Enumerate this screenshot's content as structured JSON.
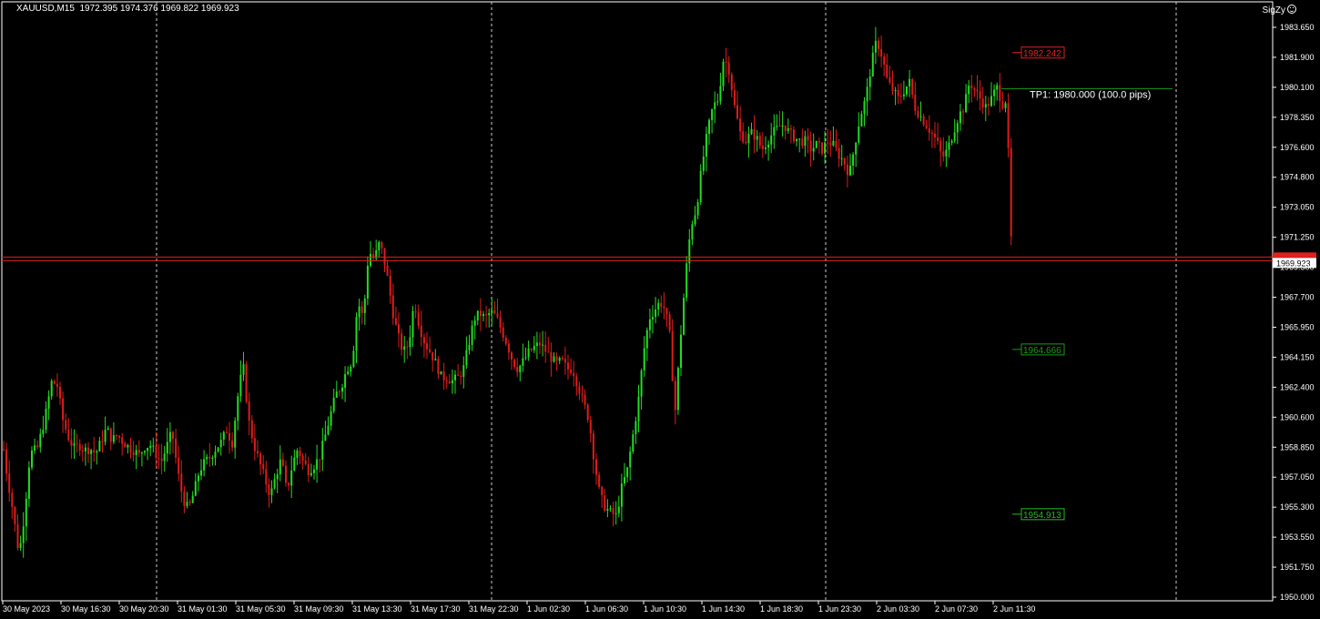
{
  "window": {
    "symbol_tf": "XAUUSD,M15",
    "ohlc": "1972.395 1974.376 1969.822 1969.923",
    "brand": "SigZy"
  },
  "colors": {
    "background": "#000000",
    "bull": "#22dd22",
    "bear": "#dd1c1c",
    "grid": "#cccccc",
    "axis": "#ffffff",
    "price_line": "#e0201e",
    "tp_line": "#1a9a1a"
  },
  "chart_data": {
    "type": "candlestick",
    "symbol": "XAUUSD",
    "timeframe": "M15",
    "ylim": [
      1950.0,
      1984.6
    ],
    "y_ticks": [
      "1983.650",
      "1981.900",
      "1980.100",
      "1978.350",
      "1976.600",
      "1974.800",
      "1973.050",
      "1971.250",
      "1969.500",
      "1967.700",
      "1965.950",
      "1964.150",
      "1962.400",
      "1960.600",
      "1958.850",
      "1957.050",
      "1955.300",
      "1953.550",
      "1951.750",
      "1950.000"
    ],
    "x_ticks": [
      "30 May 2023",
      "30 May 16:30",
      "30 May 20:30",
      "31 May 01:30",
      "31 May 05:30",
      "31 May 09:30",
      "31 May 13:30",
      "31 May 17:30",
      "31 May 22:30",
      "1 Jun 02:30",
      "1 Jun 06:30",
      "1 Jun 10:30",
      "1 Jun 14:30",
      "1 Jun 18:30",
      "1 Jun 23:30",
      "2 Jun 03:30",
      "2 Jun 07:30",
      "2 Jun 11:30"
    ],
    "current_price": "1969.923",
    "levels": [
      {
        "name": "level-high",
        "price": 1982.242,
        "label": "1982.242",
        "color": "#dd2222"
      },
      {
        "name": "level-mid",
        "price": 1964.666,
        "label": "1964.666",
        "color": "#1a9a1a"
      },
      {
        "name": "level-low",
        "price": 1954.913,
        "label": "1954.913",
        "color": "#22bb22"
      }
    ],
    "tp": {
      "price": 1980.0,
      "label": "TP1: 1980.000 (100.0 pips)"
    },
    "day_separators": [
      "30 May 20:30",
      "31 May 22:30",
      "1 Jun 23:30"
    ],
    "close_path": [
      [
        0,
        1960.0
      ],
      [
        6,
        1957.5
      ],
      [
        12,
        1955.5
      ],
      [
        20,
        1952.5
      ],
      [
        26,
        1955.0
      ],
      [
        32,
        1958.5
      ],
      [
        40,
        1958.8
      ],
      [
        48,
        1960.5
      ],
      [
        56,
        1962.8
      ],
      [
        62,
        1962.5
      ],
      [
        68,
        1960.5
      ],
      [
        74,
        1959.5
      ],
      [
        80,
        1958.8
      ],
      [
        86,
        1959.0
      ],
      [
        92,
        1958.7
      ],
      [
        98,
        1958.8
      ],
      [
        104,
        1958.5
      ],
      [
        110,
        1959.2
      ],
      [
        116,
        1960.0
      ],
      [
        122,
        1959.3
      ],
      [
        128,
        1959.6
      ],
      [
        134,
        1959.2
      ],
      [
        140,
        1958.9
      ],
      [
        146,
        1958.7
      ],
      [
        152,
        1958.4
      ],
      [
        158,
        1958.9
      ],
      [
        164,
        1959.0
      ],
      [
        170,
        1958.5
      ],
      [
        176,
        1958.0
      ],
      [
        182,
        1958.9
      ],
      [
        188,
        1959.8
      ],
      [
        194,
        1957.5
      ],
      [
        200,
        1955.8
      ],
      [
        206,
        1955.2
      ],
      [
        212,
        1956.2
      ],
      [
        218,
        1957.5
      ],
      [
        224,
        1958.0
      ],
      [
        230,
        1958.3
      ],
      [
        236,
        1958.8
      ],
      [
        242,
        1959.2
      ],
      [
        248,
        1959.9
      ],
      [
        254,
        1959.1
      ],
      [
        260,
        1961.8
      ],
      [
        266,
        1963.8
      ],
      [
        272,
        1960.5
      ],
      [
        278,
        1959.0
      ],
      [
        284,
        1958.0
      ],
      [
        290,
        1957.0
      ],
      [
        296,
        1956.0
      ],
      [
        302,
        1957.2
      ],
      [
        308,
        1958.2
      ],
      [
        314,
        1956.2
      ],
      [
        320,
        1957.8
      ],
      [
        326,
        1958.8
      ],
      [
        332,
        1958.0
      ],
      [
        338,
        1957.5
      ],
      [
        344,
        1957.8
      ],
      [
        350,
        1958.3
      ],
      [
        356,
        1959.5
      ],
      [
        362,
        1960.8
      ],
      [
        368,
        1962.0
      ],
      [
        374,
        1962.5
      ],
      [
        380,
        1963.5
      ],
      [
        386,
        1964.0
      ],
      [
        392,
        1967.5
      ],
      [
        398,
        1966.5
      ],
      [
        404,
        1970.5
      ],
      [
        410,
        1970.0
      ],
      [
        416,
        1971.0
      ],
      [
        420,
        1970.2
      ],
      [
        426,
        1968.5
      ],
      [
        430,
        1967.0
      ],
      [
        436,
        1965.5
      ],
      [
        442,
        1964.5
      ],
      [
        448,
        1965.0
      ],
      [
        454,
        1967.5
      ],
      [
        460,
        1966.0
      ],
      [
        466,
        1965.0
      ],
      [
        472,
        1964.5
      ],
      [
        478,
        1963.8
      ],
      [
        484,
        1963.0
      ],
      [
        490,
        1963.0
      ],
      [
        496,
        1962.8
      ],
      [
        502,
        1963.0
      ],
      [
        508,
        1963.5
      ],
      [
        514,
        1965.0
      ],
      [
        520,
        1966.5
      ],
      [
        526,
        1966.8
      ],
      [
        532,
        1966.5
      ],
      [
        538,
        1966.9
      ],
      [
        544,
        1966.6
      ],
      [
        550,
        1965.8
      ],
      [
        556,
        1965.0
      ],
      [
        562,
        1964.0
      ],
      [
        568,
        1963.5
      ],
      [
        574,
        1964.0
      ],
      [
        580,
        1964.5
      ],
      [
        586,
        1964.8
      ],
      [
        592,
        1965.0
      ],
      [
        598,
        1964.6
      ],
      [
        604,
        1964.2
      ],
      [
        610,
        1963.8
      ],
      [
        616,
        1964.0
      ],
      [
        622,
        1963.5
      ],
      [
        628,
        1963.5
      ],
      [
        634,
        1962.5
      ],
      [
        640,
        1961.5
      ],
      [
        646,
        1960.5
      ],
      [
        652,
        1958.0
      ],
      [
        658,
        1956.0
      ],
      [
        664,
        1955.3
      ],
      [
        670,
        1955.0
      ],
      [
        676,
        1954.8
      ],
      [
        682,
        1956.5
      ],
      [
        688,
        1957.5
      ],
      [
        694,
        1959.5
      ],
      [
        700,
        1961.5
      ],
      [
        706,
        1964.5
      ],
      [
        712,
        1966.5
      ],
      [
        718,
        1967.0
      ],
      [
        724,
        1967.5
      ],
      [
        730,
        1967.0
      ],
      [
        736,
        1965.0
      ],
      [
        740,
        1960.5
      ],
      [
        746,
        1965.0
      ],
      [
        752,
        1969.0
      ],
      [
        758,
        1972.0
      ],
      [
        764,
        1973.0
      ],
      [
        770,
        1975.5
      ],
      [
        776,
        1977.5
      ],
      [
        782,
        1979.0
      ],
      [
        788,
        1979.5
      ],
      [
        794,
        1982.0
      ],
      [
        800,
        1981.2
      ],
      [
        806,
        1979.0
      ],
      [
        812,
        1977.5
      ],
      [
        818,
        1977.0
      ],
      [
        824,
        1977.5
      ],
      [
        830,
        1977.2
      ],
      [
        836,
        1976.5
      ],
      [
        842,
        1977.0
      ],
      [
        848,
        1977.5
      ],
      [
        854,
        1977.8
      ],
      [
        860,
        1978.0
      ],
      [
        866,
        1977.5
      ],
      [
        872,
        1977.2
      ],
      [
        878,
        1977.0
      ],
      [
        884,
        1977.0
      ],
      [
        890,
        1976.5
      ],
      [
        896,
        1976.8
      ],
      [
        902,
        1976.5
      ],
      [
        908,
        1977.0
      ],
      [
        914,
        1976.8
      ],
      [
        920,
        1976.2
      ],
      [
        926,
        1975.8
      ],
      [
        932,
        1975.0
      ],
      [
        938,
        1976.8
      ],
      [
        944,
        1978.5
      ],
      [
        950,
        1979.5
      ],
      [
        956,
        1981.5
      ],
      [
        962,
        1983.0
      ],
      [
        968,
        1982.0
      ],
      [
        974,
        1980.5
      ],
      [
        980,
        1980.0
      ],
      [
        986,
        1979.5
      ],
      [
        992,
        1980.0
      ],
      [
        998,
        1980.5
      ],
      [
        1004,
        1979.0
      ],
      [
        1010,
        1978.5
      ],
      [
        1016,
        1978.0
      ],
      [
        1022,
        1977.5
      ],
      [
        1028,
        1977.0
      ],
      [
        1034,
        1976.0
      ],
      [
        1040,
        1976.5
      ],
      [
        1046,
        1977.5
      ],
      [
        1052,
        1978.5
      ],
      [
        1058,
        1979.0
      ],
      [
        1064,
        1980.5
      ],
      [
        1070,
        1980.0
      ],
      [
        1076,
        1979.5
      ],
      [
        1082,
        1979.0
      ],
      [
        1088,
        1979.5
      ],
      [
        1094,
        1980.2
      ],
      [
        1100,
        1979.2
      ],
      [
        1105,
        1979.5
      ],
      [
        1108,
        1973.5
      ],
      [
        1110,
        1970.8
      ],
      [
        1112,
        1969.923
      ]
    ]
  }
}
